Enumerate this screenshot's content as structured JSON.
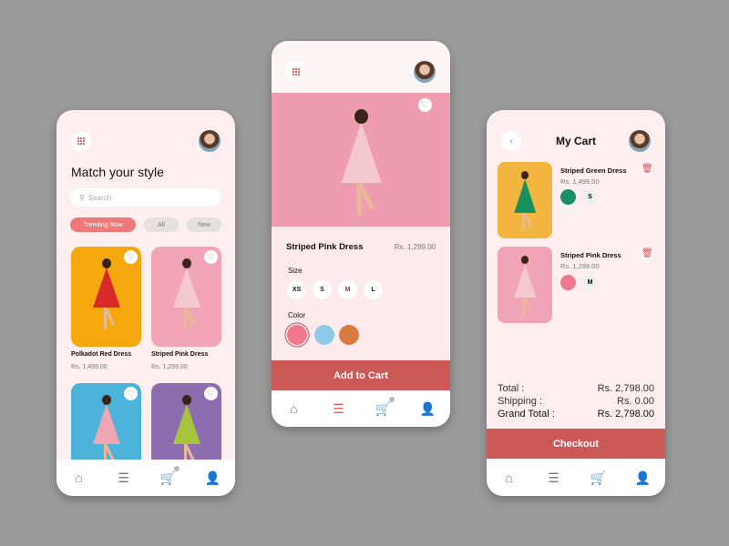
{
  "colors": {
    "background": "#9a9a9a",
    "phone_bg": "#fdeef0",
    "accent": "#cc5858",
    "chip_active": "#ef7878",
    "chip_inactive": "#e4e0e0"
  },
  "screen_home": {
    "title": "Match your style",
    "search_placeholder": "Search",
    "chips": [
      {
        "label": "Trending Now",
        "active": true
      },
      {
        "label": "All",
        "active": false
      },
      {
        "label": "New",
        "active": false
      }
    ],
    "products": [
      {
        "name": "Polkadot Red Dress",
        "price": "Rs.  1,499.00",
        "bg": "#f5a80e",
        "dress": "#d92a2a"
      },
      {
        "name": "Striped Pink Dress",
        "price": "Rs.  1,299.00",
        "bg": "#f0a4b6",
        "dress": "#f4c8cf"
      },
      {
        "name": "",
        "price": "",
        "bg": "#4bb3d9",
        "dress": "#f0a6b2"
      },
      {
        "name": "",
        "price": "",
        "bg": "#8e6cb0",
        "dress": "#a6c43a"
      }
    ],
    "nav": [
      "home-icon",
      "list-icon",
      "cart-icon",
      "profile-icon"
    ],
    "nav_active": 0
  },
  "screen_detail": {
    "product_name": "Striped Pink Dress",
    "price": "Rs.  1,299.00",
    "size_label": "Size",
    "sizes": [
      "XS",
      "S",
      "M",
      "L"
    ],
    "selected_size": "M",
    "color_label": "Color",
    "colors": [
      "#f0788e",
      "#8ecae8",
      "#d97a40"
    ],
    "selected_color": 0,
    "add_to_cart": "Add to Cart",
    "nav_active": 1
  },
  "screen_cart": {
    "title": "My Cart",
    "items": [
      {
        "name": "Striped Green Dress",
        "price": "Rs.  1,499.00",
        "color": "#1a8f6a",
        "size": "S",
        "bg": "#f2b640",
        "dress": "#16905c"
      },
      {
        "name": "Striped Pink Dress",
        "price": "Rs.  1,299.00",
        "color": "#f0788e",
        "size": "M",
        "bg": "#f0a4b6",
        "dress": "#f4c8cf"
      }
    ],
    "summary": [
      {
        "label": "Total :",
        "value": "Rs. 2,798.00"
      },
      {
        "label": "Shipping :",
        "value": "Rs. 0.00"
      },
      {
        "label": "Grand Total :",
        "value": "Rs. 2,798.00"
      }
    ],
    "checkout": "Checkout",
    "nav_active": 2
  }
}
